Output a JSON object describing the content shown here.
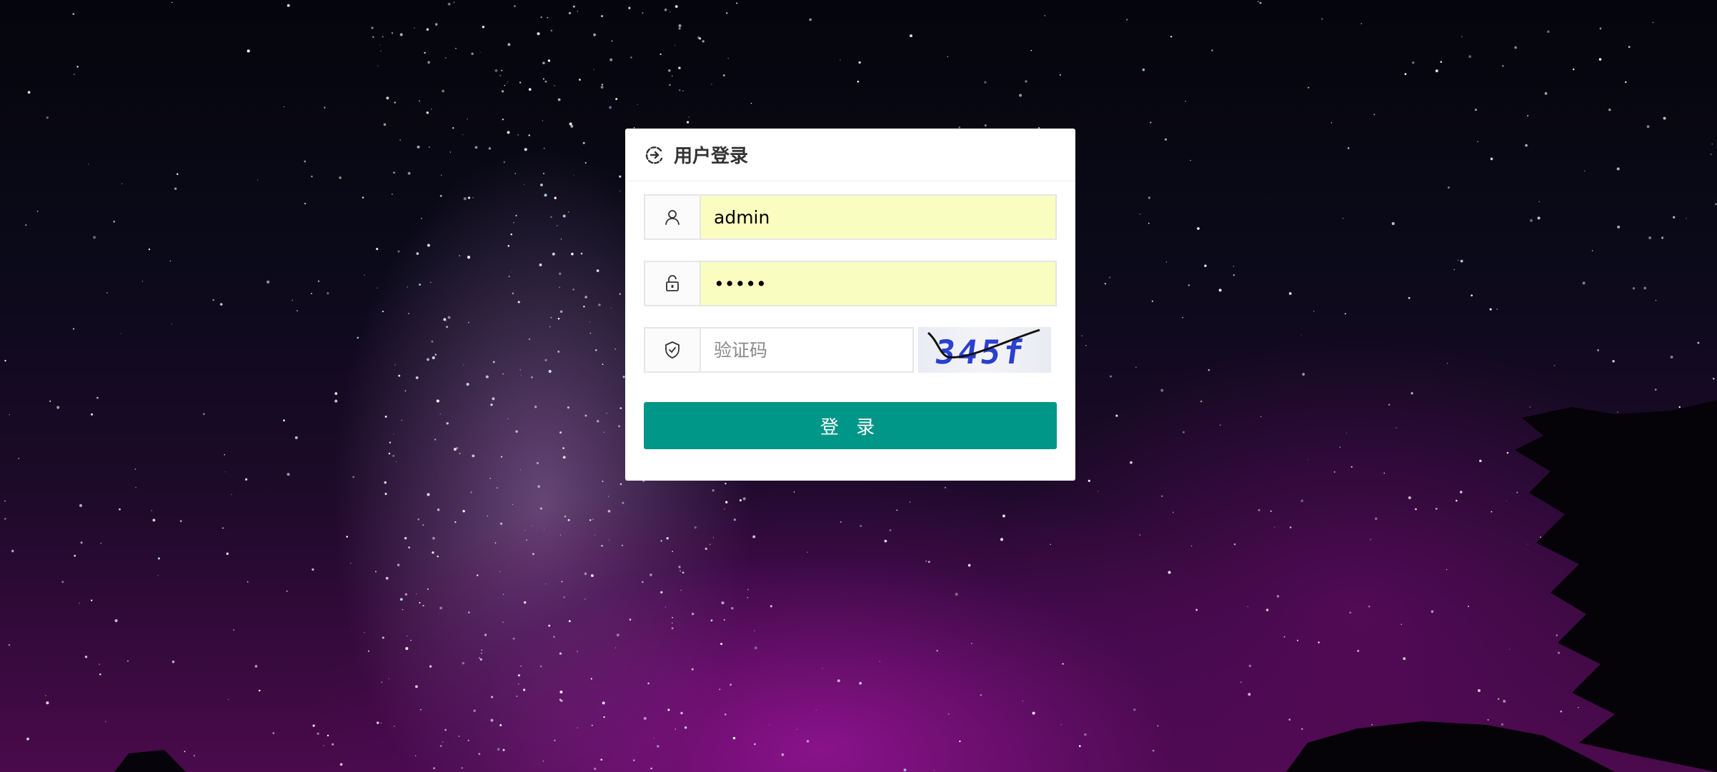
{
  "login": {
    "title": "用户登录",
    "username": {
      "value": "admin",
      "icon": "user-icon"
    },
    "password": {
      "value": "•••••",
      "icon": "lock-icon"
    },
    "captcha": {
      "placeholder": "验证码",
      "icon": "shield-check-icon",
      "image_text": "345f"
    },
    "submit_label": "登 录",
    "header_icon": "refresh-icon"
  },
  "colors": {
    "primary": "#009688",
    "autofill": "#fafdc0",
    "panel": "#ffffff"
  }
}
